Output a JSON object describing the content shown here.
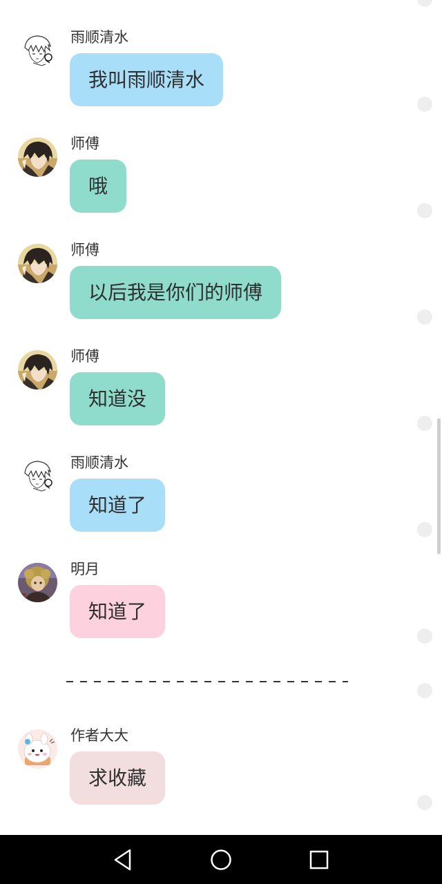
{
  "colors": {
    "blue_bubble": "#a9def9",
    "teal_bubble": "#8fdccd",
    "pink_bubble": "#fdd2de",
    "rose_bubble": "#f2dedf",
    "background": "#ffffff",
    "navbar": "#000000"
  },
  "messages": [
    {
      "name": "雨顺清水",
      "text": "我叫雨顺清水",
      "avatar": "sketch-boy-avatar",
      "bubble_color": "#a9def9"
    },
    {
      "name": "师傅",
      "text": "哦",
      "avatar": "dark-hair-anime-avatar",
      "bubble_color": "#8fdccd"
    },
    {
      "name": "师傅",
      "text": "以后我是你们的师傅",
      "avatar": "dark-hair-anime-avatar",
      "bubble_color": "#8fdccd"
    },
    {
      "name": "师傅",
      "text": "知道没",
      "avatar": "dark-hair-anime-avatar",
      "bubble_color": "#8fdccd"
    },
    {
      "name": "雨顺清水",
      "text": "知道了",
      "avatar": "sketch-boy-avatar",
      "bubble_color": "#a9def9"
    },
    {
      "name": "明月",
      "text": "知道了",
      "avatar": "curly-hair-girl-avatar",
      "bubble_color": "#fdd2de"
    },
    {
      "name": "作者大大",
      "text": "求收藏",
      "avatar": "white-bunny-avatar",
      "bubble_color": "#f2dedf"
    }
  ],
  "separator": "dashed-divider",
  "navbar": {
    "back": "back-triangle-icon",
    "home": "home-circle-icon",
    "recents": "recents-square-icon"
  }
}
